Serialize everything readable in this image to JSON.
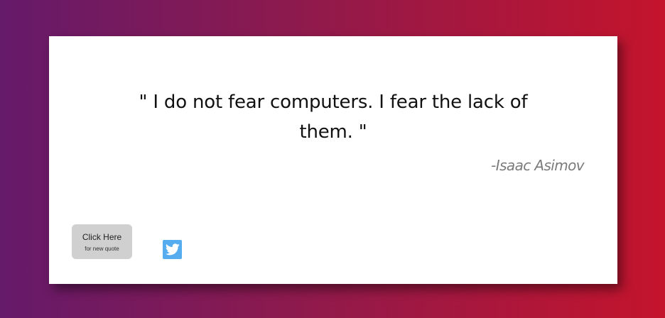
{
  "quote": {
    "text": "\" I do not fear computers. I fear the lack of them. \"",
    "author": "-Isaac Asimov"
  },
  "new_quote_button": {
    "label": "Click Here",
    "sublabel": "for new quote"
  },
  "share": {
    "icon": "twitter-icon",
    "color": "#55acee"
  },
  "theme": {
    "gradient_start": "#651a6a",
    "gradient_end": "#c4142c",
    "card_background": "#ffffff",
    "button_background": "#d0d0d0",
    "author_color": "#7a7a7a"
  }
}
